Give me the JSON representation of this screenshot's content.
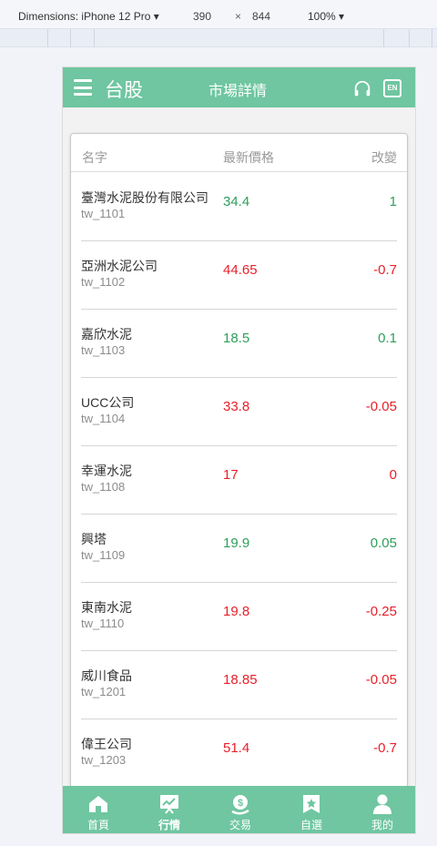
{
  "devtools": {
    "dimensions_label": "Dimensions: iPhone 12 Pro ▾",
    "width": "390",
    "times": "×",
    "height": "844",
    "zoom": "100% ▾"
  },
  "header": {
    "market": "台股",
    "title": "市場詳情",
    "lang_badge": "EN"
  },
  "table": {
    "headers": [
      "名字",
      "最新價格",
      "改變"
    ],
    "rows": [
      {
        "name": "臺灣水泥股份有限公司",
        "code": "tw_1101",
        "price": "34.4",
        "change": "1",
        "dir": "up"
      },
      {
        "name": "亞洲水泥公司",
        "code": "tw_1102",
        "price": "44.65",
        "change": "-0.7",
        "dir": "down"
      },
      {
        "name": "嘉欣水泥",
        "code": "tw_1103",
        "price": "18.5",
        "change": "0.1",
        "dir": "up"
      },
      {
        "name": "UCC公司",
        "code": "tw_1104",
        "price": "33.8",
        "change": "-0.05",
        "dir": "down"
      },
      {
        "name": "幸運水泥",
        "code": "tw_1108",
        "price": "17",
        "change": "0",
        "dir": "down"
      },
      {
        "name": "興塔",
        "code": "tw_1109",
        "price": "19.9",
        "change": "0.05",
        "dir": "up"
      },
      {
        "name": "東南水泥",
        "code": "tw_1110",
        "price": "19.8",
        "change": "-0.25",
        "dir": "down"
      },
      {
        "name": "威川食品",
        "code": "tw_1201",
        "price": "18.85",
        "change": "-0.05",
        "dir": "down"
      },
      {
        "name": "偉王公司",
        "code": "tw_1203",
        "price": "51.4",
        "change": "-0.7",
        "dir": "down"
      }
    ]
  },
  "tabs": [
    {
      "label": "首頁",
      "icon": "home-icon"
    },
    {
      "label": "行情",
      "icon": "chart-icon"
    },
    {
      "label": "交易",
      "icon": "trade-icon"
    },
    {
      "label": "自選",
      "icon": "bookmark-icon"
    },
    {
      "label": "我的",
      "icon": "user-icon"
    }
  ],
  "active_tab": "行情",
  "colors": {
    "accent": "#6fc6a0",
    "up": "#2e9e5b",
    "down": "#e8202a"
  }
}
